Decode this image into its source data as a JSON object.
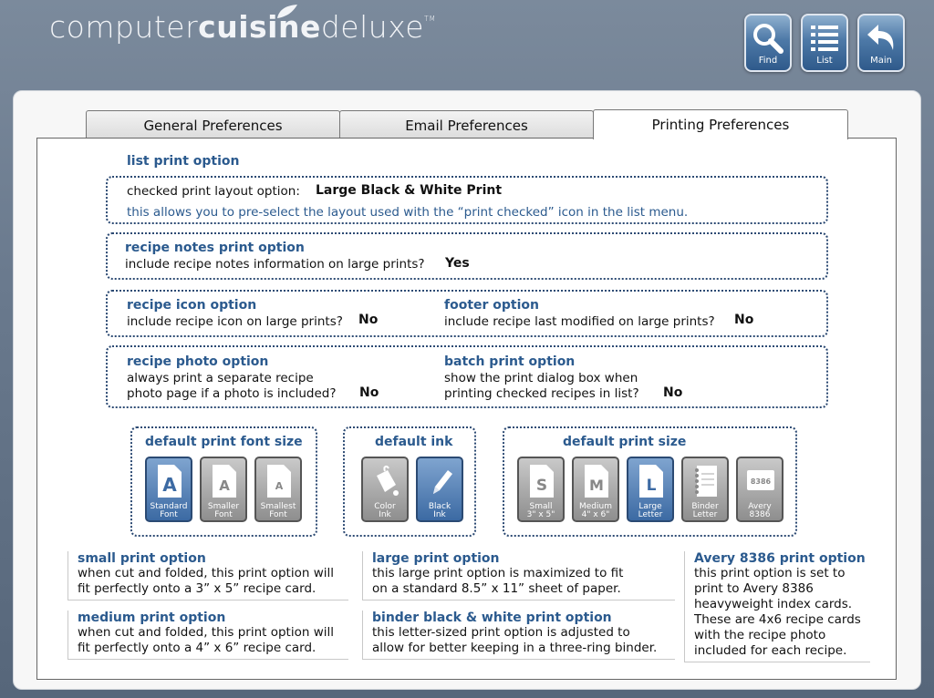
{
  "brand": {
    "part1": "computer",
    "part2": "cuisine",
    "part3": "deluxe",
    "tm": "TM"
  },
  "topbar": {
    "find": "Find",
    "list": "List",
    "main": "Main"
  },
  "tabs": [
    "General Preferences",
    "Email Preferences",
    "Printing Preferences"
  ],
  "list_print": {
    "title": "list print option",
    "label": "checked print layout option:",
    "value": "Large Black & White Print",
    "note": "this allows you to pre-select the layout used with the “print checked” icon in the list menu."
  },
  "notes_print": {
    "title": "recipe notes print option",
    "label": "include recipe notes information on large prints?",
    "value": "Yes"
  },
  "icon_opt": {
    "title": "recipe icon option",
    "label": "include recipe icon on large prints?",
    "value": "No"
  },
  "footer_opt": {
    "title": "footer option",
    "label": "include recipe last modified on large prints?",
    "value": "No"
  },
  "photo_opt": {
    "title": "recipe photo option",
    "line1": "always print a separate recipe",
    "line2": "photo page if a photo is included?",
    "value": "No"
  },
  "batch_opt": {
    "title": "batch print option",
    "line1": "show the print dialog box when",
    "line2": "printing checked recipes in list?",
    "value": "No"
  },
  "font_size": {
    "title": "default print font size",
    "options": [
      {
        "l1": "Standard",
        "l2": "Font"
      },
      {
        "l1": "Smaller",
        "l2": "Font"
      },
      {
        "l1": "Smallest",
        "l2": "Font"
      }
    ],
    "selected": 0
  },
  "ink": {
    "title": "default ink",
    "options": [
      {
        "l1": "Color",
        "l2": "Ink"
      },
      {
        "l1": "Black",
        "l2": "Ink"
      }
    ],
    "selected": 1
  },
  "print_size": {
    "title": "default print size",
    "options": [
      {
        "l1": "Small",
        "l2": "3\" x 5\"",
        "glyph": "S"
      },
      {
        "l1": "Medium",
        "l2": "4\" x 6\"",
        "glyph": "M"
      },
      {
        "l1": "Large",
        "l2": "Letter",
        "glyph": "L"
      },
      {
        "l1": "Binder",
        "l2": "Letter",
        "glyph": ""
      },
      {
        "l1": "Avery",
        "l2": "8386",
        "glyph": "8386"
      }
    ],
    "selected": 2
  },
  "descriptions": {
    "small": {
      "title": "small print option",
      "lines": [
        "when cut and folded, this print option will",
        "fit perfectly onto a 3” x 5” recipe card."
      ]
    },
    "medium": {
      "title": "medium print option",
      "lines": [
        "when cut and folded, this print option will",
        "fit perfectly onto a 4” x 6” recipe card."
      ]
    },
    "large": {
      "title": "large print option",
      "lines": [
        "this large print option is maximized to fit",
        "on a standard 8.5” x 11” sheet of paper."
      ]
    },
    "binder": {
      "title": "binder black & white print option",
      "lines": [
        "this letter-sized print option is adjusted to",
        "allow for better keeping in a three-ring binder."
      ]
    },
    "avery": {
      "title": "Avery 8386 print option",
      "lines": [
        "this print option is set to",
        "print to Avery 8386",
        "heavyweight index cards.",
        "These are 4x6 recipe cards",
        "with the recipe photo",
        "included for each recipe."
      ]
    }
  }
}
